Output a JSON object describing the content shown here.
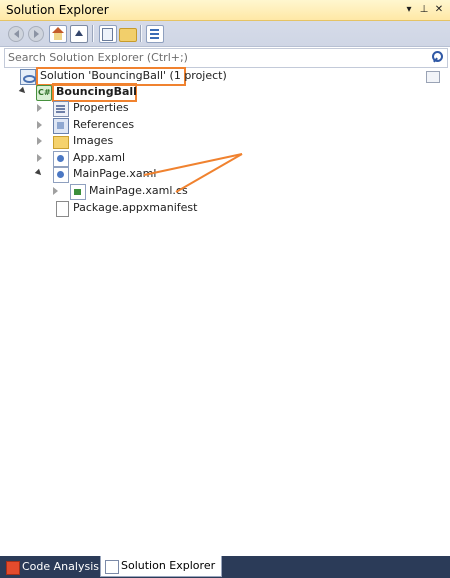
{
  "window": {
    "title": "Solution Explorer",
    "pin_icon": "pin-icon",
    "close_icon": "close-icon",
    "dropdown_icon": "dropdown-arrow-icon"
  },
  "toolbar": {
    "buttons": [
      {
        "name": "back",
        "icon": "back-arrow-icon"
      },
      {
        "name": "forward",
        "icon": "forward-arrow-icon"
      },
      {
        "name": "home",
        "icon": "home-icon"
      },
      {
        "name": "collapse-all",
        "icon": "collapse-icon"
      },
      {
        "name": "show-all-files",
        "icon": "pages-icon"
      },
      {
        "name": "new-folder",
        "icon": "folder-icon"
      },
      {
        "name": "properties",
        "icon": "properties-icon"
      }
    ]
  },
  "search": {
    "placeholder": "Search Solution Explorer (Ctrl+;)",
    "icon": "search-icon"
  },
  "tree": {
    "solution": "Solution 'BouncingBall' (1 project)",
    "project": "BouncingBall",
    "items": [
      {
        "label": "Properties",
        "icon": "properties-icon"
      },
      {
        "label": "References",
        "icon": "references-icon"
      },
      {
        "label": "Images",
        "icon": "folder-icon"
      },
      {
        "label": "App.xaml",
        "icon": "xaml-icon"
      },
      {
        "label": "MainPage.xaml",
        "icon": "xaml-icon"
      },
      {
        "label": "MainPage.xaml.cs",
        "icon": "csharp-file-icon"
      },
      {
        "label": "Package.appxmanifest",
        "icon": "manifest-file-icon"
      }
    ]
  },
  "bottom_tabs": [
    {
      "label": "Code Analysis",
      "icon": "code-analysis-icon"
    },
    {
      "label": "Solution Explorer",
      "icon": "solution-explorer-icon"
    }
  ],
  "colors": {
    "highlight": "#f0822f",
    "title_bar": "#ffe8a6",
    "toolbar": "#cfd6e5",
    "chrome": "#2b3b58"
  }
}
